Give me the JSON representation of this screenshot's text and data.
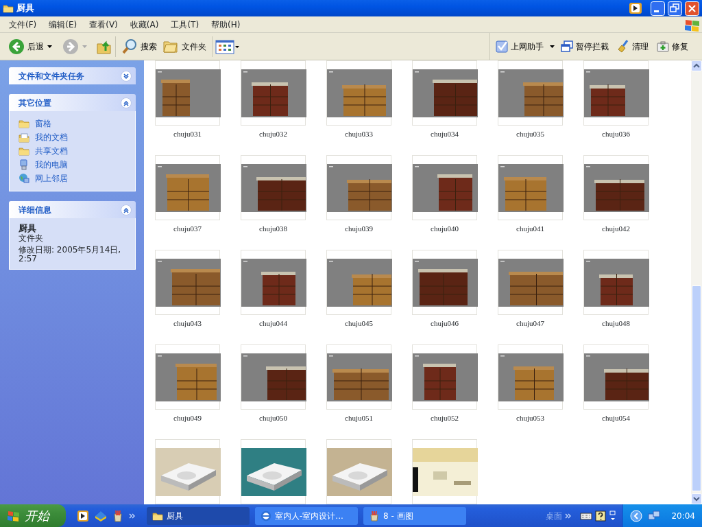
{
  "window": {
    "title": "厨具"
  },
  "menu": [
    "文件(F)",
    "编辑(E)",
    "查看(V)",
    "收藏(A)",
    "工具(T)",
    "帮助(H)"
  ],
  "toolbar": {
    "back": "后退",
    "search": "搜索",
    "folders": "文件夹"
  },
  "addon_toolbar": [
    {
      "kind": "helper",
      "label": "上网助手"
    },
    {
      "kind": "popup",
      "label": "暂停拦截"
    },
    {
      "kind": "clean",
      "label": "清理"
    },
    {
      "kind": "repair",
      "label": "修复"
    }
  ],
  "tasks_panel": {
    "title": "文件和文件夹任务",
    "expanded": false
  },
  "places_panel": {
    "title": "其它位置",
    "expanded": true,
    "items": [
      {
        "kind": "folder",
        "label": "窗格"
      },
      {
        "kind": "documents",
        "label": "我的文档"
      },
      {
        "kind": "folder",
        "label": "共享文档"
      },
      {
        "kind": "computer",
        "label": "我的电脑"
      },
      {
        "kind": "network",
        "label": "网上邻居"
      }
    ]
  },
  "details_panel": {
    "title": "详细信息",
    "expanded": true,
    "name": "厨具",
    "type": "文件夹",
    "modified": "修改日期: 2005年5月14日, 2:57"
  },
  "files": [
    {
      "name": "chuju031"
    },
    {
      "name": "chuju032"
    },
    {
      "name": "chuju033"
    },
    {
      "name": "chuju034"
    },
    {
      "name": "chuju035"
    },
    {
      "name": "chuju036"
    },
    {
      "name": "chuju037"
    },
    {
      "name": "chuju038"
    },
    {
      "name": "chuju039"
    },
    {
      "name": "chuju040"
    },
    {
      "name": "chuju041"
    },
    {
      "name": "chuju042"
    },
    {
      "name": "chuju043"
    },
    {
      "name": "chuju044"
    },
    {
      "name": "chuju045"
    },
    {
      "name": "chuju046"
    },
    {
      "name": "chuju047"
    },
    {
      "name": "chuju048"
    },
    {
      "name": "chuju049"
    },
    {
      "name": "chuju050"
    },
    {
      "name": "chuju051"
    },
    {
      "name": "chuju052"
    },
    {
      "name": "chuju053"
    },
    {
      "name": "chuju054"
    },
    {
      "kind": "picture"
    },
    {
      "kind": "picture"
    },
    {
      "kind": "picture"
    },
    {
      "kind": "picture"
    }
  ],
  "taskbar": {
    "start": "开始",
    "tasks": [
      {
        "label": "厨具",
        "selected": true
      },
      {
        "label": "室内人-室内设计...",
        "selected": false
      },
      {
        "label": "8 - 画图",
        "selected": false
      }
    ],
    "desktop": "桌面",
    "clock": "20:04"
  }
}
